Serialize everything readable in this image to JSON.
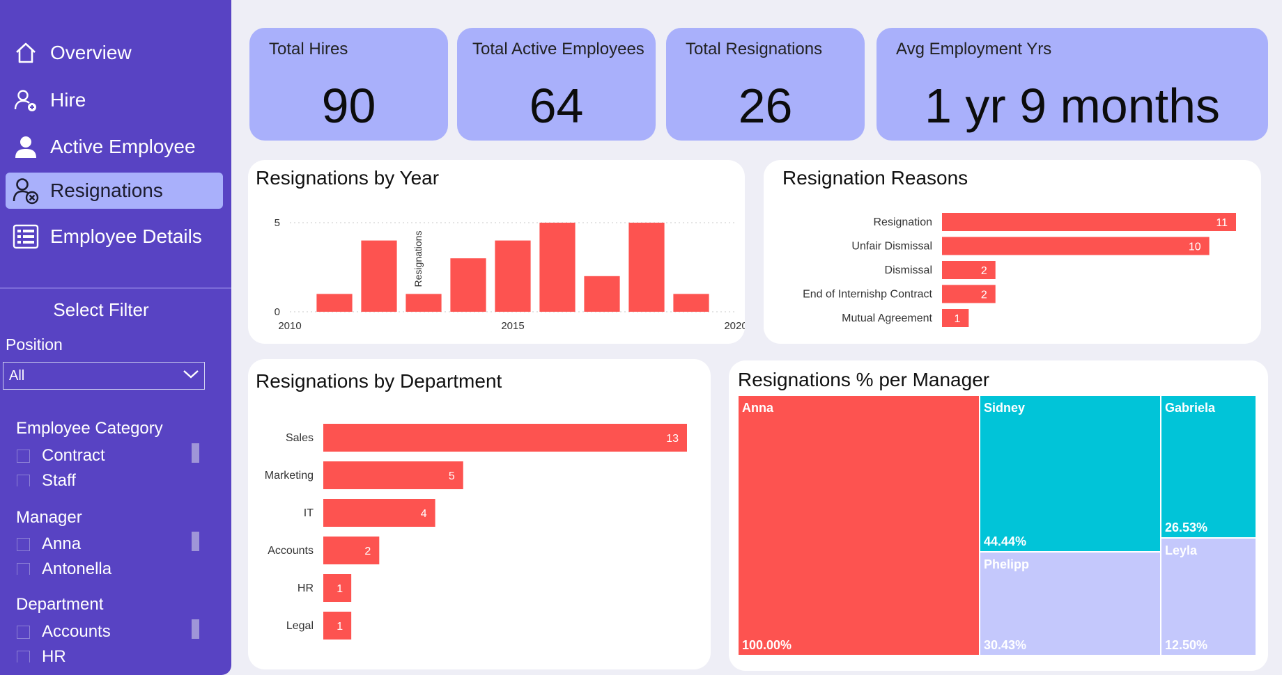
{
  "sidebar": {
    "nav": [
      {
        "label": "Overview",
        "icon": "home-icon",
        "active": false
      },
      {
        "label": "Hire",
        "icon": "add-user-icon",
        "active": false
      },
      {
        "label": "Active Employee",
        "icon": "user-icon",
        "active": false
      },
      {
        "label": "Resignations",
        "icon": "remove-user-icon",
        "active": true
      },
      {
        "label": "Employee Details",
        "icon": "grid-list-icon",
        "active": false
      }
    ],
    "filter_title": "Select Filter",
    "position": {
      "label": "Position",
      "value": "All"
    },
    "slicers": [
      {
        "title": "Employee Category",
        "items": [
          "Contract",
          "Staff"
        ]
      },
      {
        "title": "Manager",
        "items": [
          "Anna",
          "Antonella"
        ]
      },
      {
        "title": "Department",
        "items": [
          "Accounts",
          "HR"
        ]
      }
    ]
  },
  "kpis": [
    {
      "label": "Total Hires",
      "value": "90"
    },
    {
      "label": "Total Active Employees",
      "value": "64"
    },
    {
      "label": "Total Resignations",
      "value": "26"
    },
    {
      "label": "Avg Employment Yrs",
      "value": "1 yr 9 months"
    }
  ],
  "charts": {
    "by_year": {
      "type": "bar",
      "title": "Resignations by Year",
      "ylabel": "Resignations",
      "x": [
        2011,
        2012,
        2013,
        2014,
        2015,
        2016,
        2017,
        2018,
        2019
      ],
      "values": [
        1,
        4,
        1,
        3,
        4,
        5,
        2,
        5,
        1
      ],
      "xticks": [
        "2010",
        "2015",
        "2020"
      ],
      "xlim": [
        2010,
        2020
      ],
      "yticks": [
        "0",
        "5"
      ],
      "ylim": [
        0,
        5
      ],
      "color": "#fd5350"
    },
    "reasons": {
      "type": "bar",
      "title": "Resignation Reasons",
      "categories": [
        "Resignation",
        "Unfair Dismissal",
        "Dismissal",
        "End of Internishp Contract",
        "Mutual Agreement"
      ],
      "values": [
        11,
        10,
        2,
        2,
        1
      ],
      "color": "#fd5350"
    },
    "by_department": {
      "type": "bar",
      "title": "Resignations by Department",
      "categories": [
        "Sales",
        "Marketing",
        "IT",
        "Accounts",
        "HR",
        "Legal"
      ],
      "values": [
        13,
        5,
        4,
        2,
        1,
        1
      ],
      "color": "#fd5350"
    },
    "per_manager": {
      "type": "treemap",
      "title": "Resignations % per Manager",
      "cells": [
        {
          "name": "Anna",
          "pct": "100.00%",
          "color": "#fd5350"
        },
        {
          "name": "Sidney",
          "pct": "44.44%",
          "color": "#01c4d8"
        },
        {
          "name": "Phelipp",
          "pct": "30.43%",
          "color": "#c4c8fc"
        },
        {
          "name": "Gabriela",
          "pct": "26.53%",
          "color": "#01c4d8"
        },
        {
          "name": "Leyla",
          "pct": "12.50%",
          "color": "#c4c8fc"
        }
      ]
    }
  }
}
